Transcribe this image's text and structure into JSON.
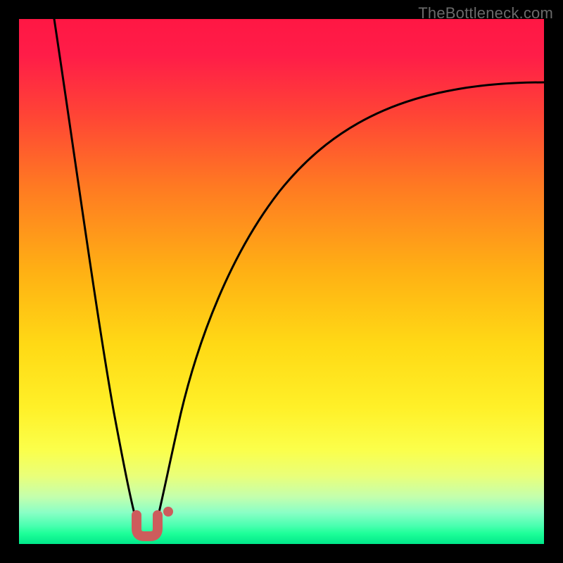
{
  "watermark": "TheBottleneck.com",
  "colors": {
    "frame": "#000000",
    "curve": "#000000",
    "marker": "#cd5c5c",
    "gradient_top": "#ff1744",
    "gradient_mid": "#ffe838",
    "gradient_bottom": "#00e88a"
  },
  "chart_data": {
    "type": "line",
    "title": "",
    "xlabel": "",
    "ylabel": "",
    "xlim": [
      0,
      100
    ],
    "ylim": [
      0,
      100
    ],
    "grid": false,
    "legend": false,
    "series": [
      {
        "name": "curve",
        "x": [
          6.7,
          10.0,
          13.4,
          16.8,
          20.2,
          22.5,
          24.4,
          25.8,
          27.0,
          30.0,
          35.0,
          42.0,
          50.0,
          60.0,
          75.0,
          90.0,
          100.0
        ],
        "y": [
          100.0,
          78.0,
          56.0,
          36.0,
          18.0,
          7.0,
          1.0,
          2.0,
          6.0,
          18.0,
          35.0,
          52.0,
          67.0,
          77.0,
          84.0,
          87.0,
          88.0
        ]
      }
    ],
    "annotations": [
      {
        "name": "highlight-u-marker",
        "x": 24.4,
        "y": 1.5,
        "shape": "U",
        "color": "#cd5c5c"
      },
      {
        "name": "highlight-dot",
        "x": 28.4,
        "y": 6.1,
        "shape": "dot",
        "color": "#cd5c5c"
      }
    ],
    "background": {
      "type": "vertical-gradient",
      "description": "red at top → orange → yellow → green at bottom (lower y = better)"
    }
  }
}
